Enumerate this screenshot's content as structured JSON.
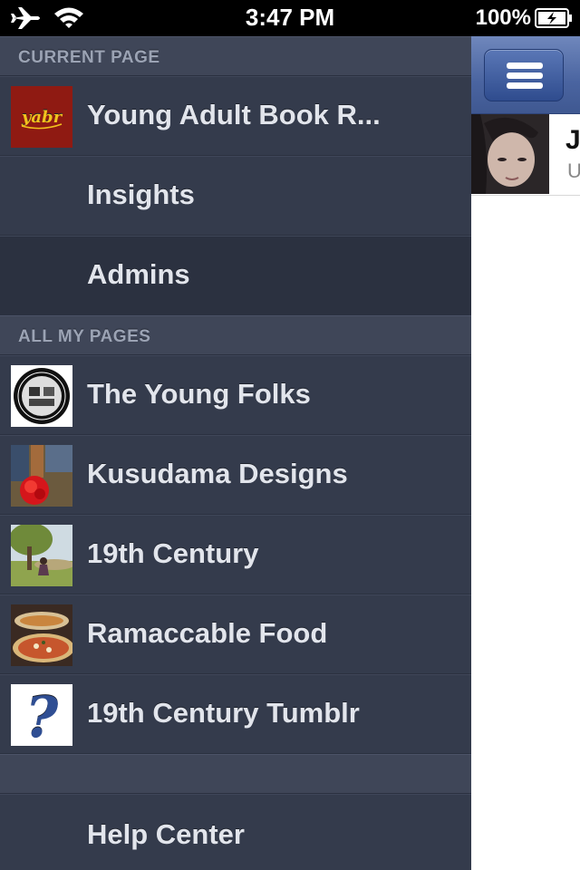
{
  "status_bar": {
    "time": "3:47 PM",
    "battery_percent": "100%",
    "icons": [
      "airplane-icon",
      "wifi-icon",
      "battery-charging-icon"
    ]
  },
  "menu": {
    "current_page_header": "CURRENT PAGE",
    "current_page": {
      "title": "Young Adult Book R...",
      "thumb_text": "yabr",
      "items": [
        {
          "label": "Insights"
        },
        {
          "label": "Admins",
          "selected": true
        }
      ]
    },
    "all_pages_header": "ALL MY PAGES",
    "pages": [
      {
        "label": "The Young Folks"
      },
      {
        "label": "Kusudama Designs"
      },
      {
        "label": "19th Century"
      },
      {
        "label": "Ramaccable Food"
      },
      {
        "label": "19th Century Tumblr",
        "thumb_text": "?"
      }
    ],
    "help_center": "Help Center"
  },
  "right_panel": {
    "menu_button_icon": "hamburger-icon",
    "profile_name_partial": "J",
    "profile_sub_partial": "U"
  },
  "colors": {
    "menu_bg": "#343b4c",
    "menu_selected": "#2b3140",
    "header_bg": "#3f4658",
    "nav_blue": "#4a64a0"
  }
}
